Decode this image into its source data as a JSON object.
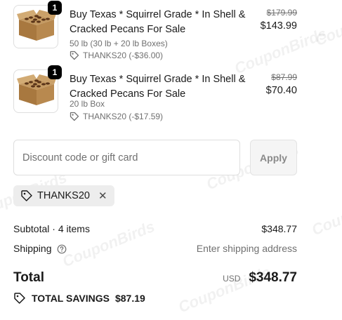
{
  "line_items": [
    {
      "quantity": "1",
      "title": "Buy Texas * Squirrel Grade * In Shell & Cracked Pecans For Sale",
      "variant": "50 lb (30 lb + 20 lb Boxes)",
      "discount": "THANKS20 (-$36.00)",
      "original_price": "$179.99",
      "price": "$143.99"
    },
    {
      "quantity": "1",
      "title": "Buy Texas * Squirrel Grade * In Shell & Cracked Pecans For Sale",
      "variant": "20 lb Box",
      "discount": "THANKS20 (-$17.59)",
      "original_price": "$87.99",
      "price": "$70.40"
    }
  ],
  "discount": {
    "placeholder": "Discount code or gift card",
    "apply_label": "Apply",
    "applied_code": "THANKS20"
  },
  "summary": {
    "subtotal_label": "Subtotal · 4 items",
    "subtotal_value": "$348.77",
    "shipping_label": "Shipping",
    "shipping_value": "Enter shipping address",
    "total_label": "Total",
    "currency": "USD",
    "total_value": "$348.77",
    "savings_label": "TOTAL SAVINGS",
    "savings_value": "$87.19"
  },
  "watermark": "CouponBirds",
  "icons": {
    "tag": "tag-icon",
    "help": "question-circle-icon",
    "remove": "close-icon"
  }
}
